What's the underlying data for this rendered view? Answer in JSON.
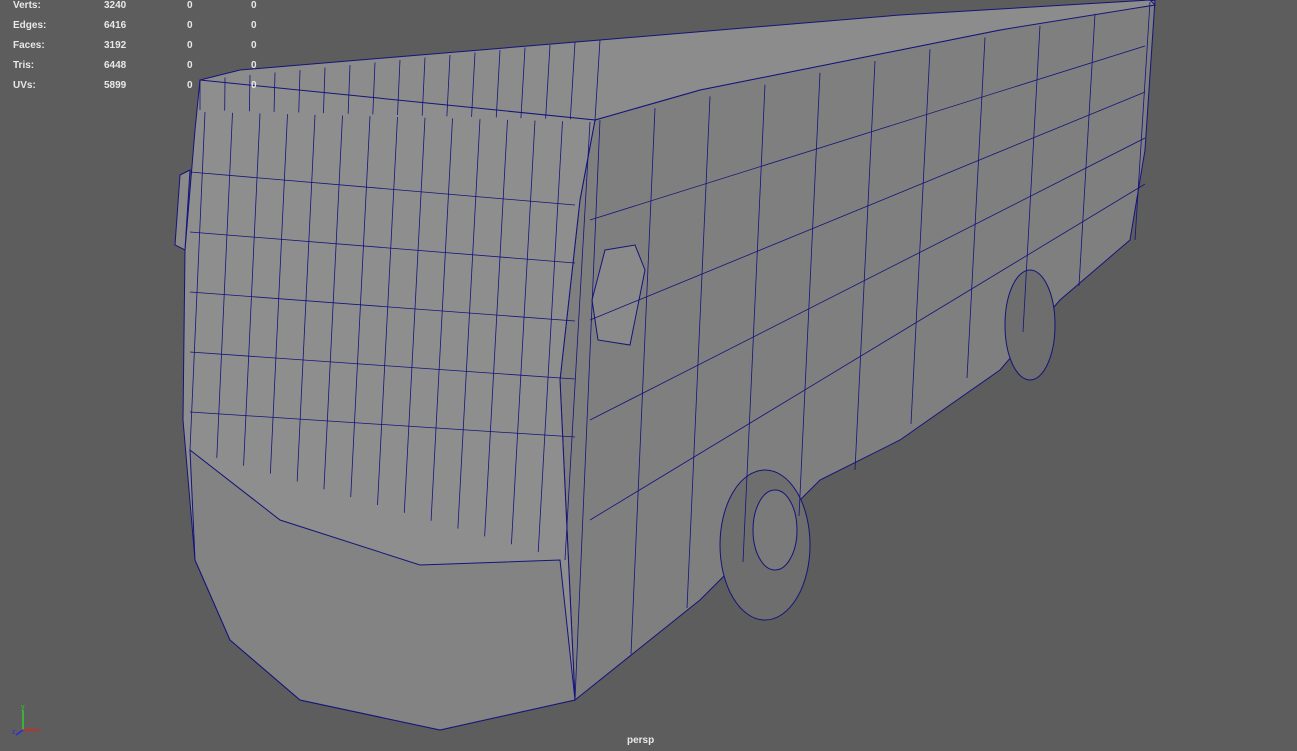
{
  "hud": {
    "rows": [
      {
        "label": "Verts:",
        "values": [
          "3240",
          "0",
          "0"
        ]
      },
      {
        "label": "Edges:",
        "values": [
          "6416",
          "0",
          "0"
        ]
      },
      {
        "label": "Faces:",
        "values": [
          "3192",
          "0",
          "0"
        ]
      },
      {
        "label": "Tris:",
        "values": [
          "6448",
          "0",
          "0"
        ]
      },
      {
        "label": "UVs:",
        "values": [
          "5899",
          "0",
          "0"
        ]
      }
    ]
  },
  "camera": "persp",
  "axis": {
    "x": "x",
    "y": "y",
    "z": "z"
  },
  "colors": {
    "background": "#5d5d5d",
    "mesh": "#8a8a8a",
    "wire": "#14147a"
  }
}
